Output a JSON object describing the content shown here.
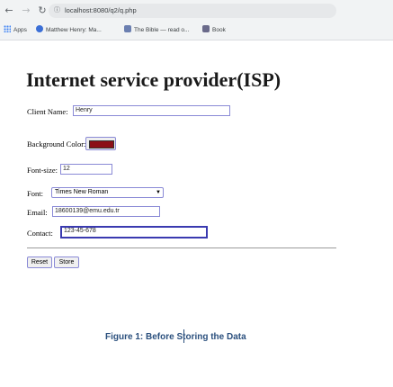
{
  "browser": {
    "url": "localhost:8080/q2/q.php",
    "bookmarks": [
      {
        "label": "Apps"
      },
      {
        "label": "Matthew Henry: Ma..."
      },
      {
        "label": "The Bible — read o..."
      },
      {
        "label": "Book"
      }
    ]
  },
  "page": {
    "title": "Internet service provider(ISP)",
    "fields": {
      "client_name": {
        "label": "Client Name:",
        "value": "Henry"
      },
      "background_color": {
        "label": "Background Color:",
        "value": "#8b0f17"
      },
      "font_size": {
        "label": "Font-size:",
        "value": "12"
      },
      "font": {
        "label": "Font:",
        "value": "Times New Roman"
      },
      "email": {
        "label": "Email:",
        "value": "18600139@emu.edu.tr"
      },
      "contact": {
        "label": "Contact:",
        "value": "123-45-678"
      }
    },
    "buttons": {
      "reset": "Reset",
      "store": "Store"
    }
  },
  "caption": "Figure 1: Before Storing the Data"
}
